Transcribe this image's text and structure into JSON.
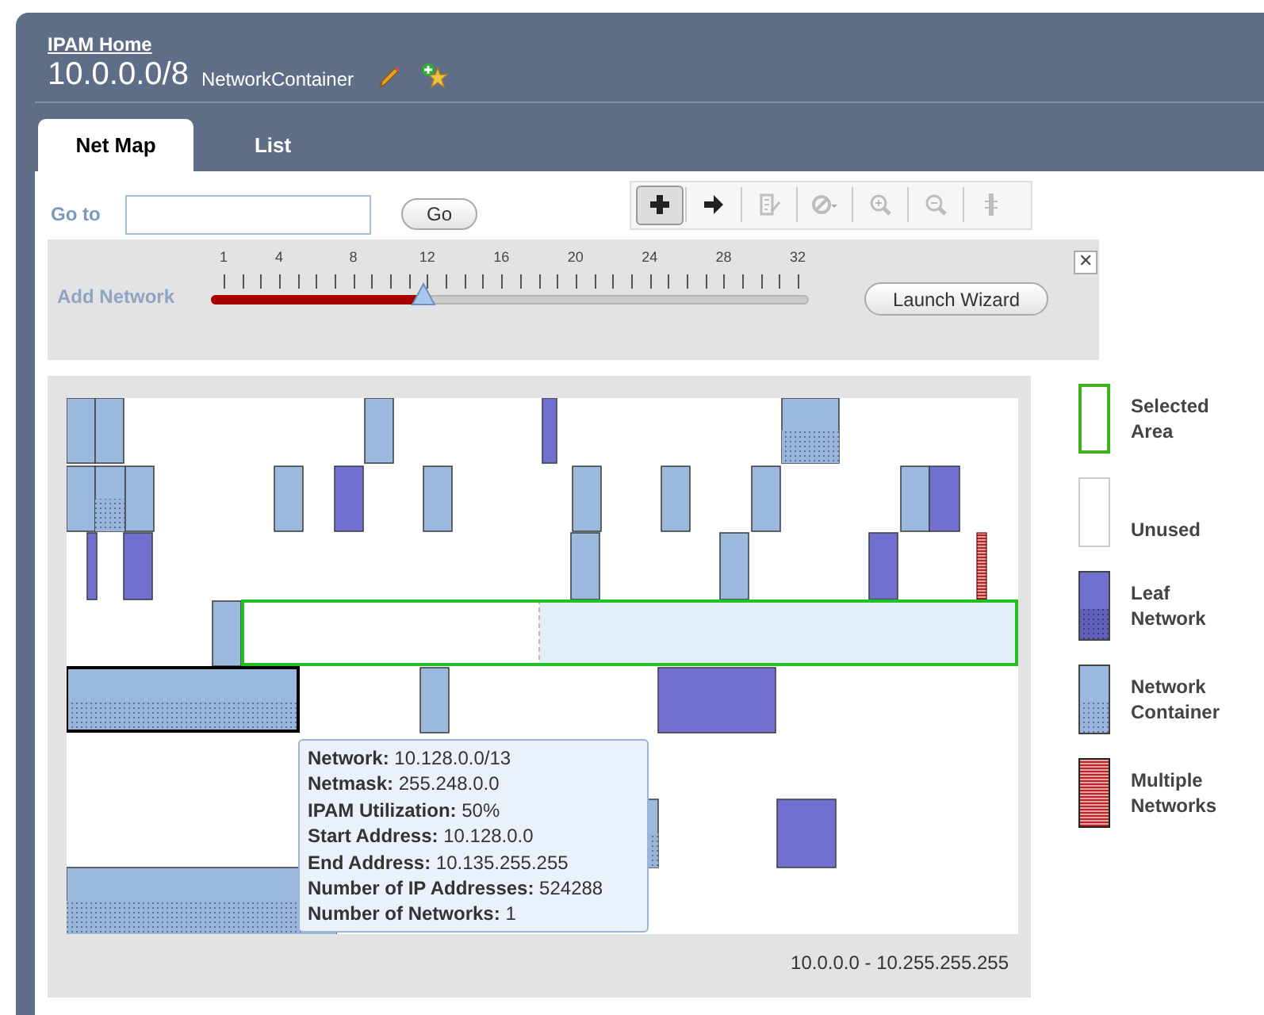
{
  "breadcrumb": "IPAM Home",
  "title": "10.0.0.0/8",
  "type_label": "NetworkContainer",
  "tabs": [
    {
      "label": "Net Map",
      "selected": true
    },
    {
      "label": "List",
      "selected": false
    }
  ],
  "goto": {
    "label": "Go to",
    "button": "Go"
  },
  "toolbar": [
    {
      "kind": "add",
      "selected": true,
      "disabled": false
    },
    {
      "kind": "next",
      "selected": false,
      "disabled": false
    },
    {
      "kind": "edit",
      "selected": false,
      "disabled": true
    },
    {
      "kind": "block",
      "selected": false,
      "disabled": true
    },
    {
      "kind": "zoom-in",
      "selected": false,
      "disabled": true
    },
    {
      "kind": "zoom-out",
      "selected": false,
      "disabled": true
    },
    {
      "kind": "split",
      "selected": false,
      "disabled": true
    }
  ],
  "add_network": {
    "label": "Add Network",
    "ticks": [
      "1",
      "4",
      "8",
      "12",
      "16",
      "20",
      "24",
      "28",
      "32"
    ],
    "level": 0.355,
    "button": "Launch Wizard",
    "close": "✕"
  },
  "tooltip": [
    "**Network:** 10.128.0.0/13",
    "**Netmask:** 255.248.0.0",
    "**IPAM Utilization:** 50%",
    "**Start Address:** 10.128.0.0",
    "**End Address:** 10.135.255.255",
    "**Number of IP Addresses:** 524288",
    "**Number of Networks:** 1"
  ],
  "range": "10.0.0.0 - 10.255.255.255",
  "legend": [
    {
      "kind": "selected",
      "label": "Selected Area"
    },
    {
      "kind": "unused",
      "label": "Unused"
    },
    {
      "kind": "leaf",
      "label": "Leaf Network"
    },
    {
      "kind": "container",
      "label": "Network Container"
    },
    {
      "kind": "multiple",
      "label": "Multiple Networks"
    }
  ]
}
